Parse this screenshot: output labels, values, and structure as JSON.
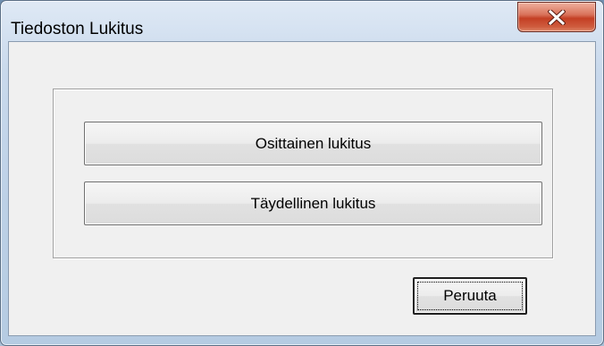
{
  "window": {
    "title": "Tiedoston Lukitus",
    "close_icon": "close-icon"
  },
  "buttons": {
    "partial_lock": "Osittainen lukitus",
    "full_lock": "Täydellinen lukitus",
    "cancel": "Peruuta"
  },
  "colors": {
    "close_button": "#c43f24",
    "dialog_background": "#f0f0f0",
    "frame": "#bcd0e6"
  }
}
